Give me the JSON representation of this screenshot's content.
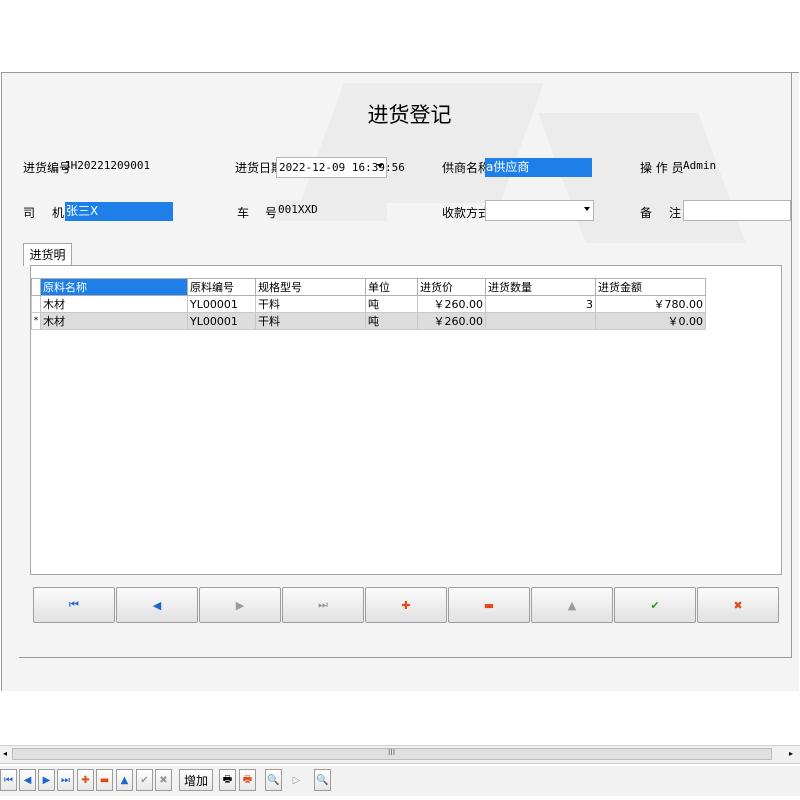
{
  "form": {
    "title": "进货登记",
    "purchase_no_label": "进货编号",
    "purchase_no": "JH20221209001",
    "purchase_date_label": "进货日期",
    "purchase_date": "2022-12-09 16:39:56",
    "supplier_label": "供商名称",
    "supplier": "a供应商",
    "operator_label": "操 作 员",
    "operator": "Admin",
    "driver_label_1": "司",
    "driver_label_2": "机",
    "driver": "张三X",
    "plate_label_1": "车",
    "plate_label_2": "号",
    "plate": "001XXD",
    "payment_label": "收款方式",
    "payment": "",
    "remark_label_1": "备",
    "remark_label_2": "注",
    "remark": ""
  },
  "tab": {
    "label": "进货明细"
  },
  "grid": {
    "columns": [
      "原料名称",
      "原料编号",
      "规格型号",
      "单位",
      "进货价",
      "进货数量",
      "进货金额"
    ],
    "rows": [
      {
        "indicator": "",
        "cells": [
          "木材",
          "YL00001",
          "干料",
          "吨",
          "￥260.00",
          "3",
          "￥780.00"
        ]
      },
      {
        "indicator": "*",
        "cells": [
          "木材",
          "YL00001",
          "干料",
          "吨",
          "￥260.00",
          "",
          "￥0.00"
        ]
      }
    ]
  },
  "nav_buttons": [
    {
      "name": "first-record-button",
      "glyph": "⏮",
      "color": "#1c66c9"
    },
    {
      "name": "prev-record-button",
      "glyph": "◀",
      "color": "#1c66c9"
    },
    {
      "name": "next-record-button",
      "glyph": "▶",
      "color": "#9a9a9a"
    },
    {
      "name": "last-record-button",
      "glyph": "⏭",
      "color": "#9a9a9a"
    },
    {
      "name": "add-record-button",
      "glyph": "✚",
      "color": "#e34a1a"
    },
    {
      "name": "delete-record-button",
      "glyph": "▬",
      "color": "#e34a1a"
    },
    {
      "name": "edit-record-button",
      "glyph": "▲",
      "color": "#9a9a9a"
    },
    {
      "name": "post-record-button",
      "glyph": "✔",
      "color": "#2e9b2e"
    },
    {
      "name": "cancel-record-button",
      "glyph": "✖",
      "color": "#e34a1a"
    }
  ],
  "toolbar": {
    "add_label": "增加",
    "scroll_grip": "III"
  }
}
